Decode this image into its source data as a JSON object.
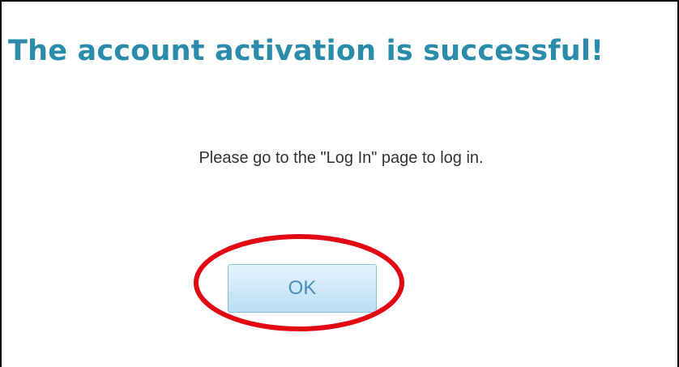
{
  "dialog": {
    "title": "The account activation is successful!",
    "message": "Please go to the \"Log In\" page to log in.",
    "ok_label": "OK"
  },
  "colors": {
    "title": "#2a8bab",
    "message": "#333333",
    "ok_text": "#4a8fb8",
    "highlight": "#e30613"
  }
}
